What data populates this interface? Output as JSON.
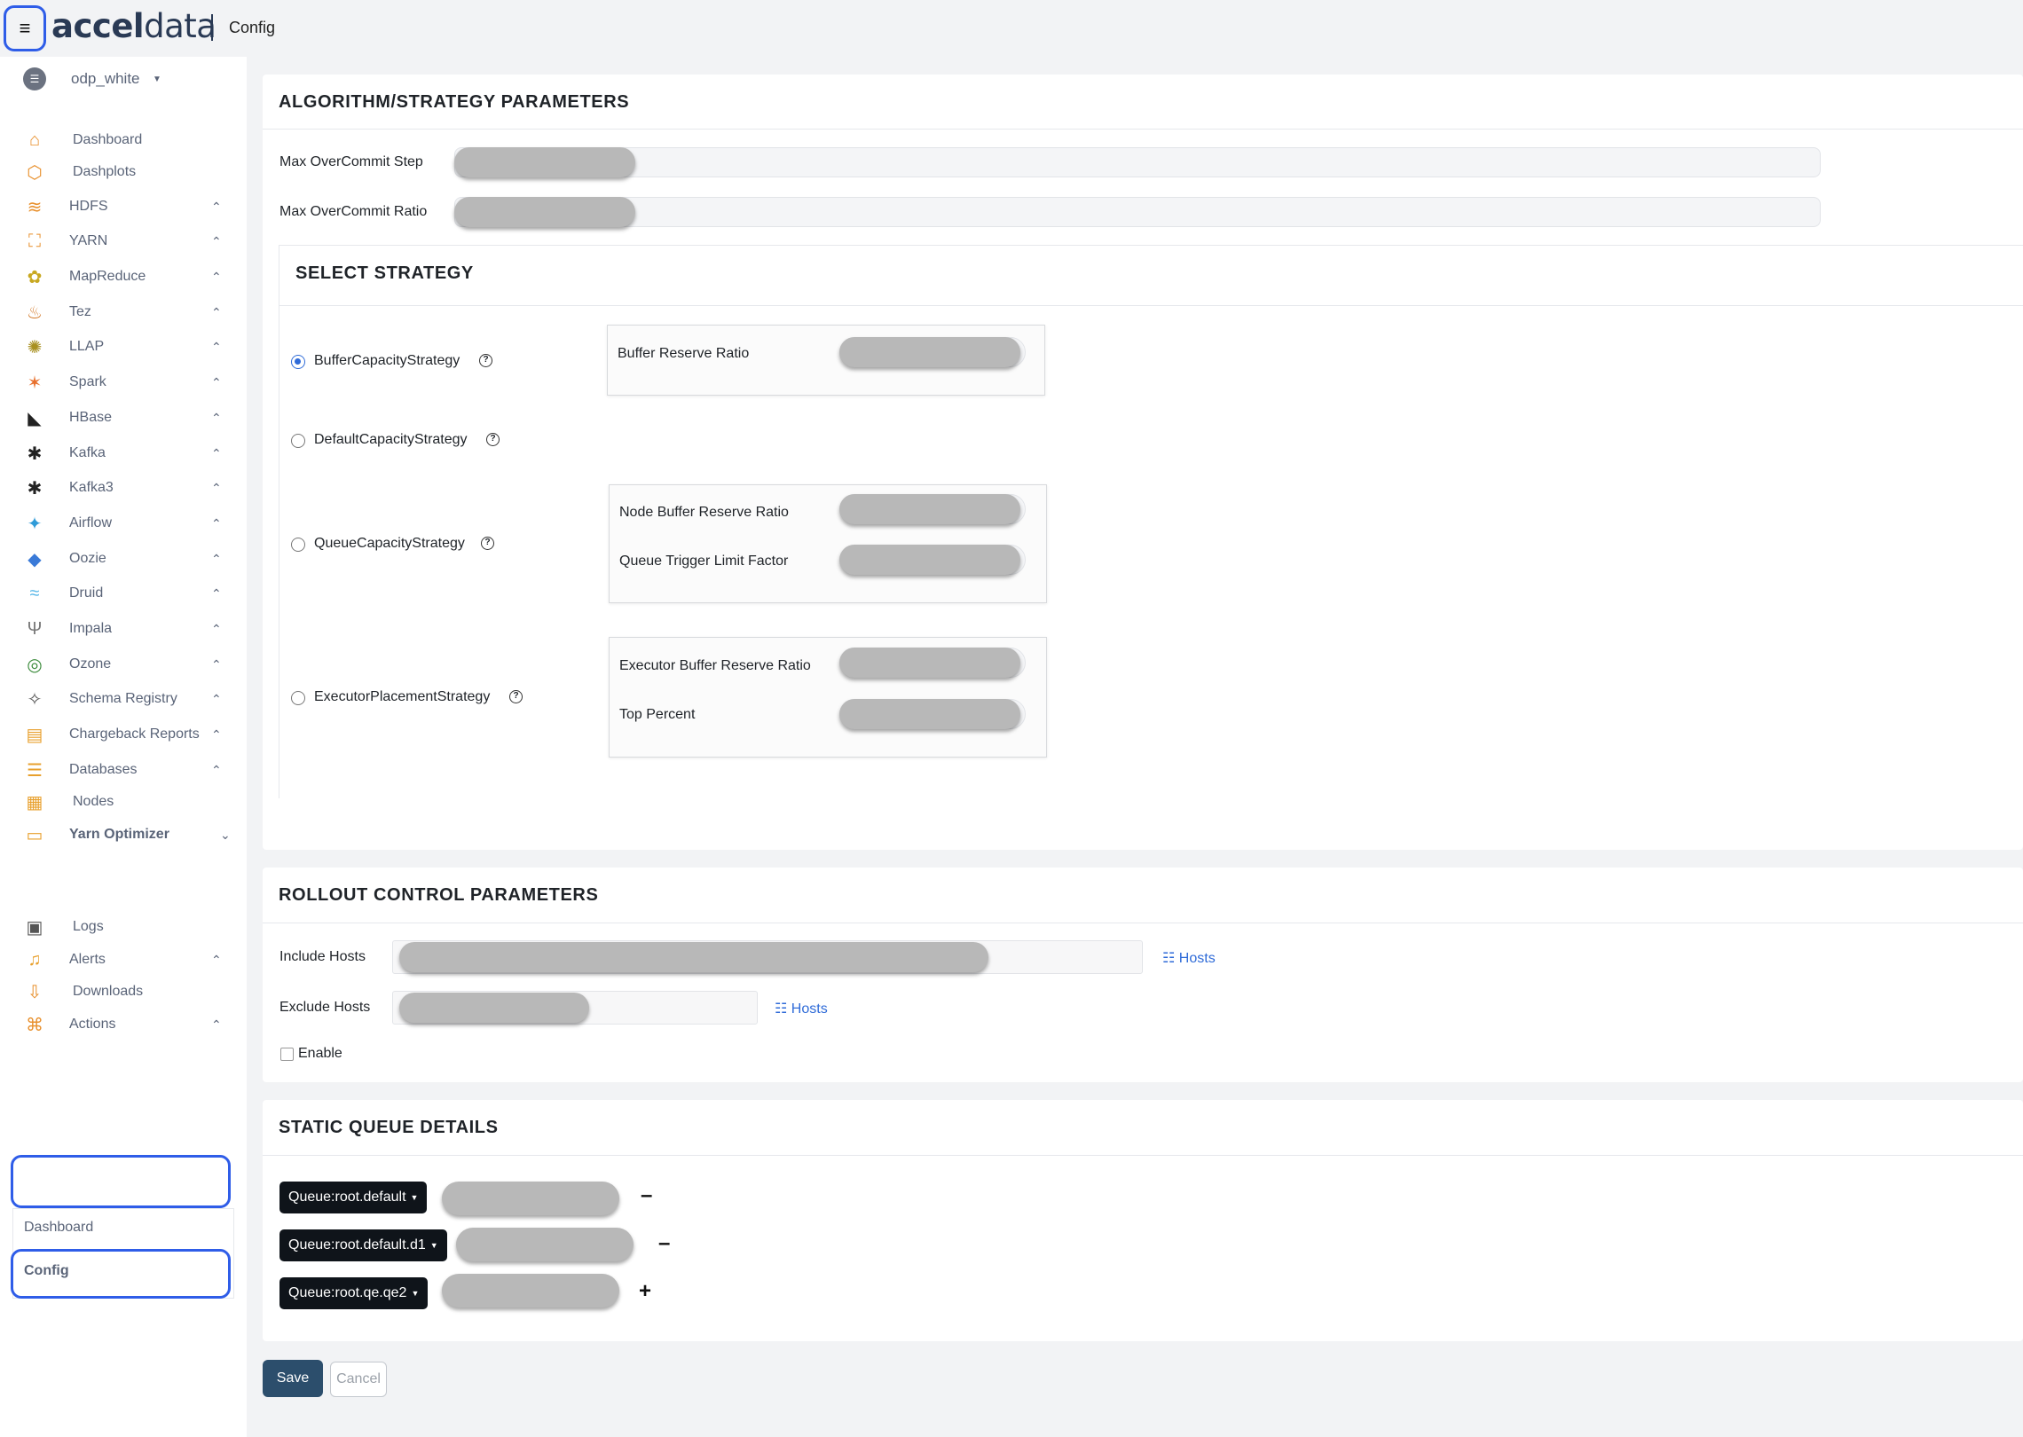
{
  "topbar": {
    "logo_bold": "accel",
    "logo_light": "data",
    "page_title": "Config"
  },
  "sidebar": {
    "cluster": "odp_white",
    "items": [
      {
        "label": "Dashboard",
        "icon": "home-icon"
      },
      {
        "label": "Dashplots",
        "icon": "cube-icon"
      },
      {
        "label": "HDFS",
        "icon": "layers-icon"
      },
      {
        "label": "YARN",
        "icon": "hierarchy-icon"
      },
      {
        "label": "MapReduce",
        "icon": "elephant-icon"
      },
      {
        "label": "Tez",
        "icon": "tez-icon"
      },
      {
        "label": "LLAP",
        "icon": "bee-icon"
      },
      {
        "label": "Spark",
        "icon": "star-icon"
      },
      {
        "label": "HBase",
        "icon": "orca-icon"
      },
      {
        "label": "Kafka",
        "icon": "kafka-icon"
      },
      {
        "label": "Kafka3",
        "icon": "kafka-icon"
      },
      {
        "label": "Airflow",
        "icon": "pinwheel-icon"
      },
      {
        "label": "Oozie",
        "icon": "oozie-icon"
      },
      {
        "label": "Druid",
        "icon": "druid-icon"
      },
      {
        "label": "Impala",
        "icon": "impala-icon"
      },
      {
        "label": "Ozone",
        "icon": "ozone-icon"
      },
      {
        "label": "Schema Registry",
        "icon": "compass-icon"
      },
      {
        "label": "Chargeback Reports",
        "icon": "report-icon"
      },
      {
        "label": "Databases",
        "icon": "database-icon"
      },
      {
        "label": "Nodes",
        "icon": "grid-icon"
      },
      {
        "label": "Yarn Optimizer",
        "icon": "optimizer-icon"
      },
      {
        "label": "Logs",
        "icon": "log-icon"
      },
      {
        "label": "Alerts",
        "icon": "bell-icon"
      },
      {
        "label": "Downloads",
        "icon": "download-icon"
      },
      {
        "label": "Actions",
        "icon": "command-icon"
      }
    ],
    "yarn_optimizer_sub": [
      "Dashboard",
      "Config"
    ]
  },
  "algorithm": {
    "title": "ALGORITHM/STRATEGY PARAMETERS",
    "max_overcommit_step": "Max OverCommit Step",
    "max_overcommit_ratio": "Max OverCommit Ratio"
  },
  "strategy": {
    "title": "SELECT STRATEGY",
    "options": [
      "BufferCapacityStrategy",
      "DefaultCapacityStrategy",
      "QueueCapacityStrategy",
      "ExecutorPlacementStrategy"
    ],
    "selected": "BufferCapacityStrategy",
    "buffer_reserve_ratio": "Buffer Reserve Ratio",
    "node_buffer_reserve_ratio": "Node Buffer Reserve Ratio",
    "queue_trigger_limit_factor": "Queue Trigger Limit Factor",
    "executor_buffer_reserve_ratio": "Executor Buffer Reserve Ratio",
    "top_percent": "Top Percent"
  },
  "rollout": {
    "title": "ROLLOUT CONTROL PARAMETERS",
    "include_hosts": "Include Hosts",
    "exclude_hosts": "Exclude Hosts",
    "hosts_link": "Hosts",
    "enable": "Enable"
  },
  "static_queue": {
    "title": "STATIC QUEUE DETAILS",
    "queues": [
      "Queue:root.default",
      "Queue:root.default.d1",
      "Queue:root.qe.qe2"
    ],
    "remove": "–",
    "add": "+"
  },
  "actions": {
    "save": "Save",
    "cancel": "Cancel"
  }
}
